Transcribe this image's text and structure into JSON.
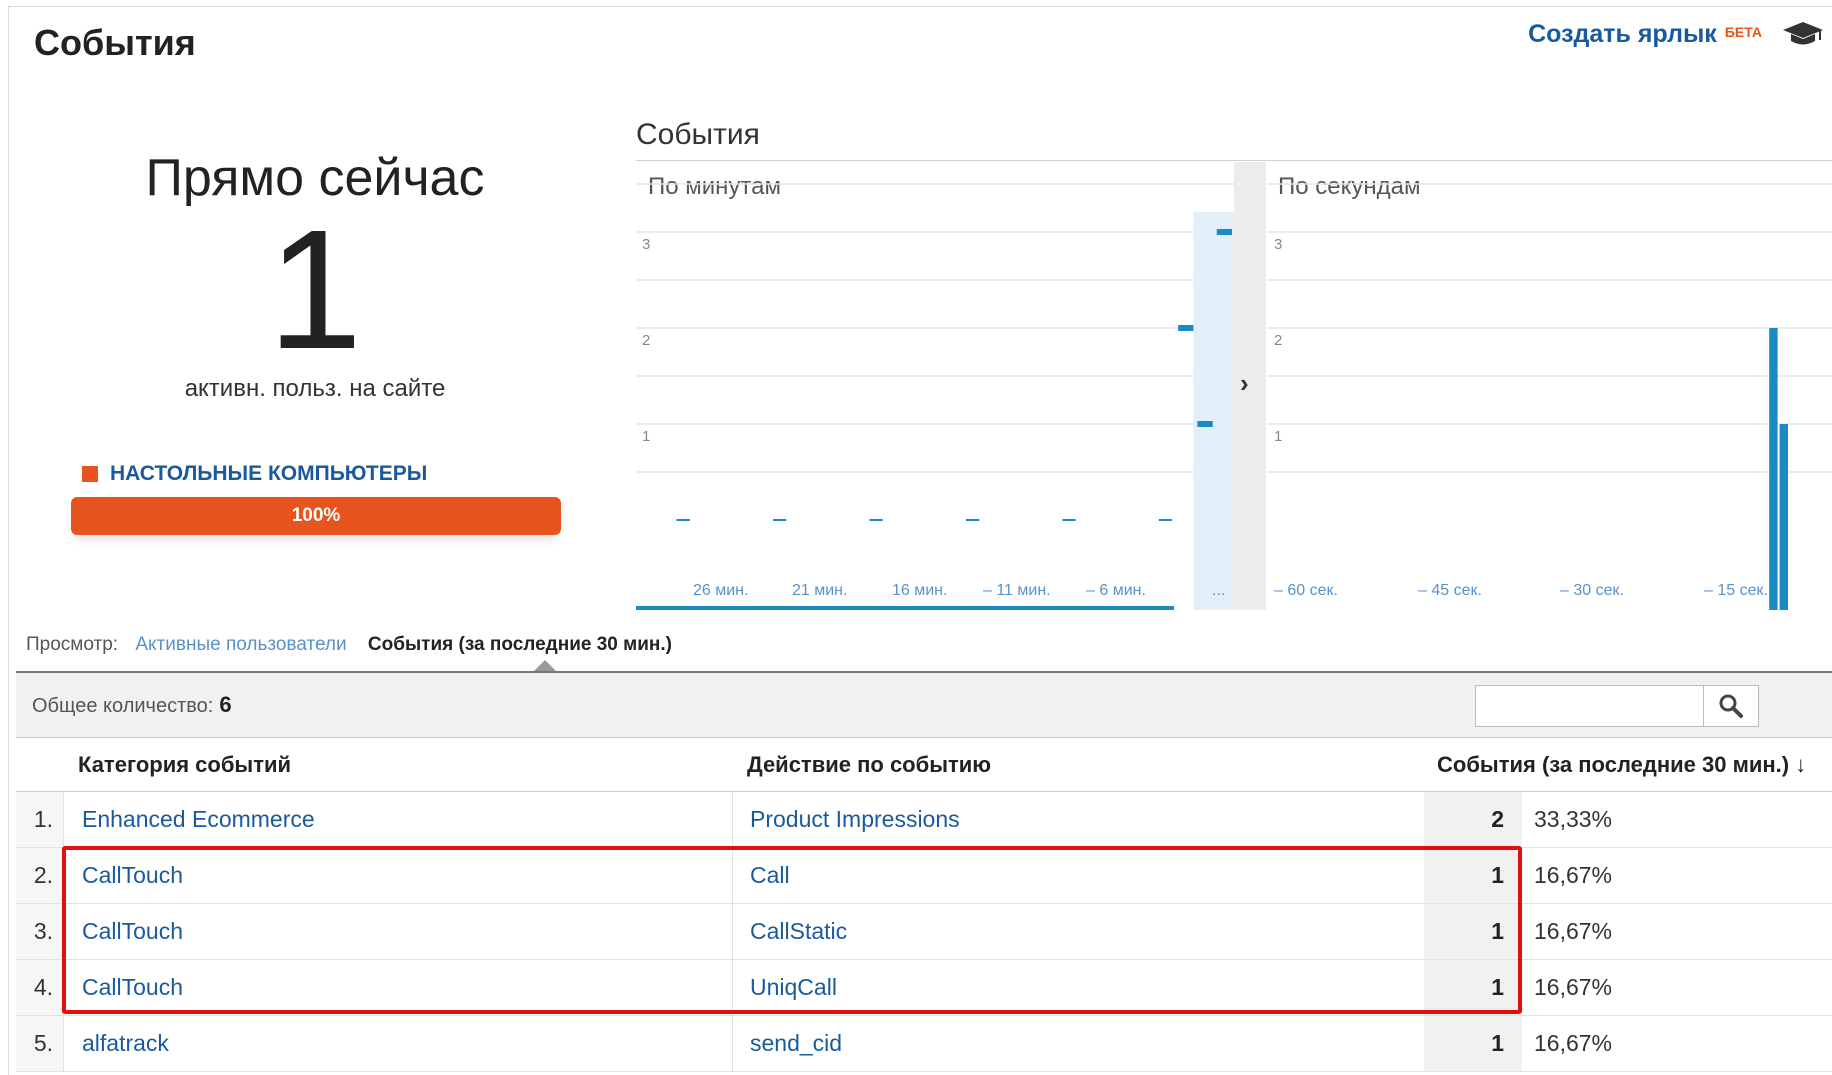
{
  "header": {
    "title": "События",
    "shortcut_label": "Создать ярлык",
    "beta_label": "БЕТА"
  },
  "now": {
    "title": "Прямо сейчас",
    "active_count": "1",
    "active_label": "активн. польз. на сайте"
  },
  "device": {
    "label": "НАСТОЛЬНЫЕ КОМПЬЮТЕРЫ",
    "percent_label": "100%",
    "share": 1.0,
    "color": "#e8541e"
  },
  "charts": {
    "title": "События",
    "minutes_label": "По минутам",
    "seconds_label": "По секундам",
    "arrow": "›"
  },
  "chart_data": [
    {
      "type": "bar",
      "title": "По минутам",
      "ylim": [
        0,
        4
      ],
      "yticks": [
        "1",
        "2",
        "3"
      ],
      "xticks": [
        "26 мин.",
        "21 мин.",
        "16 мин.",
        "– 11 мин.",
        "– 6 мин.",
        "..."
      ],
      "values": [
        0,
        0,
        0,
        0,
        0,
        0,
        0,
        0,
        0,
        0,
        0,
        0,
        0,
        0,
        0,
        0,
        0,
        0,
        0,
        0,
        0,
        0,
        0,
        0,
        0,
        0,
        0,
        0,
        2,
        1,
        3
      ],
      "color": "#1a8ac6"
    },
    {
      "type": "bar",
      "title": "По секундам",
      "ylim": [
        0,
        4
      ],
      "yticks": [
        "1",
        "2",
        "3"
      ],
      "xticks": [
        "– 60 сек.",
        "– 45 сек.",
        "– 30 сек.",
        "– 15 сек."
      ],
      "values": [
        0,
        0,
        0,
        0,
        0,
        0,
        0,
        0,
        0,
        0,
        0,
        0,
        0,
        0,
        0,
        0,
        0,
        0,
        0,
        0,
        0,
        0,
        0,
        0,
        0,
        0,
        0,
        0,
        0,
        0,
        0,
        0,
        0,
        0,
        0,
        0,
        0,
        0,
        0,
        0,
        0,
        0,
        0,
        0,
        0,
        0,
        0,
        0,
        2,
        1
      ],
      "color": "#1a8ac6"
    }
  ],
  "view": {
    "label": "Просмотр:",
    "option_users": "Активные пользователи",
    "option_events": "События (за последние 30 мин.)"
  },
  "table": {
    "total_label": "Общее количество:",
    "total_value": "6",
    "headers": {
      "category": "Категория событий",
      "action": "Действие по событию",
      "events": "События (за последние 30 мин.)"
    },
    "sort_arrow": "↓",
    "rows": [
      {
        "num": "1.",
        "category": "Enhanced Ecommerce",
        "action": "Product Impressions",
        "events": "2",
        "pct": "33,33%"
      },
      {
        "num": "2.",
        "category": "CallTouch",
        "action": "Call",
        "events": "1",
        "pct": "16,67%"
      },
      {
        "num": "3.",
        "category": "CallTouch",
        "action": "CallStatic",
        "events": "1",
        "pct": "16,67%"
      },
      {
        "num": "4.",
        "category": "CallTouch",
        "action": "UniqCall",
        "events": "1",
        "pct": "16,67%"
      },
      {
        "num": "5.",
        "category": "alfatrack",
        "action": "send_cid",
        "events": "1",
        "pct": "16,67%"
      }
    ]
  }
}
